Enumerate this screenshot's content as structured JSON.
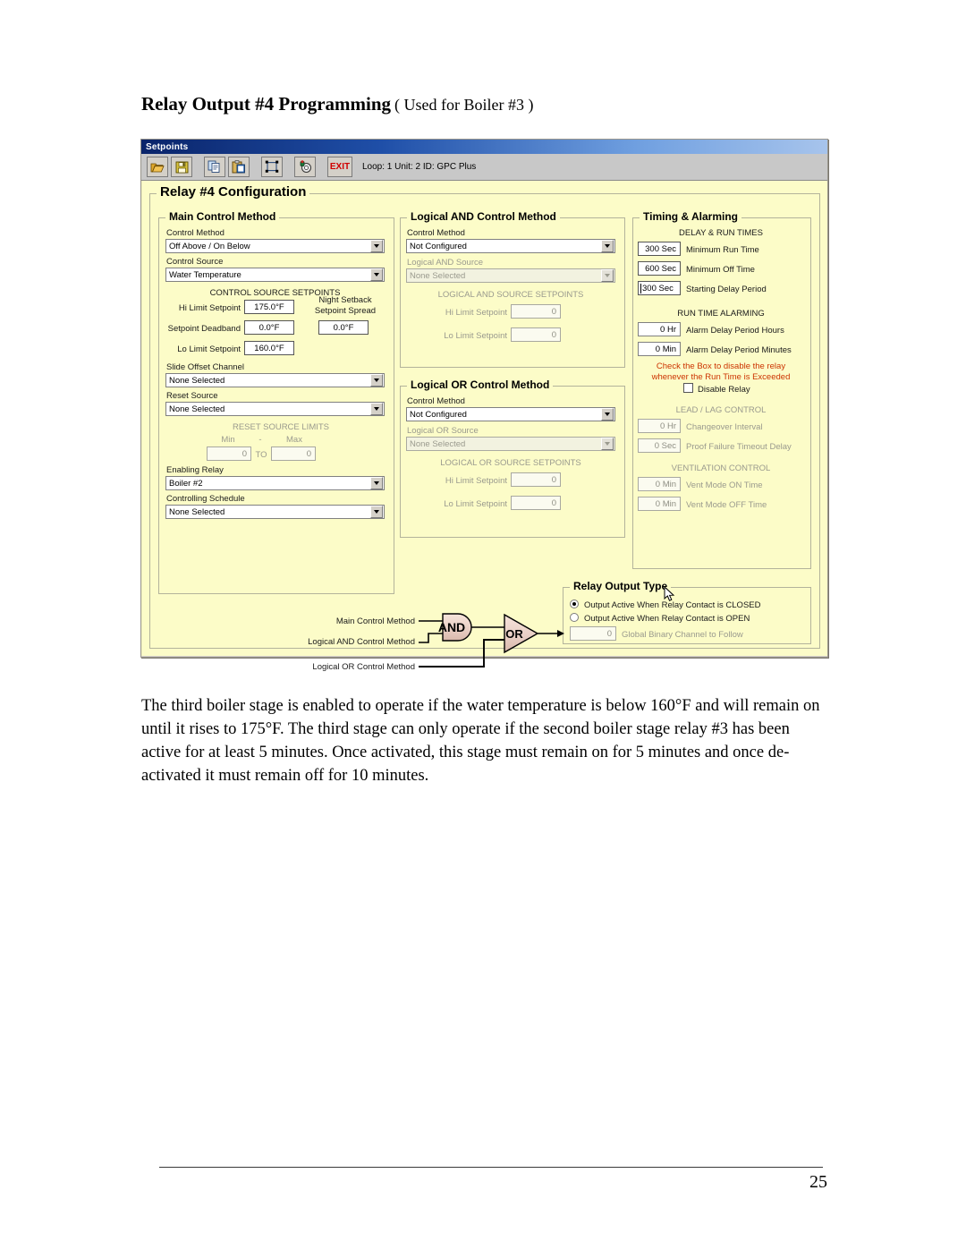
{
  "doc": {
    "heading_main": "Relay Output #4 Programming",
    "heading_sub": "( Used for Boiler #3 )",
    "paragraph": "The third boiler stage is enabled to operate if the water temperature is below 160°F and will remain on until it rises to 175°F. The third stage can only operate if the second boiler stage relay #3 has been active for at least 5 minutes. Once activated, this stage must remain on for 5 minutes and once de-activated it must remain off for 10 minutes.",
    "page_number": "25"
  },
  "window": {
    "title": "Setpoints",
    "toolbar": {
      "exit_label": "EXIT",
      "status": "Loop: 1  Unit: 2  ID: GPC Plus",
      "icons": [
        "open-folder-icon",
        "save-disk-icon",
        "copy-icon",
        "paste-icon",
        "select-frame-icon",
        "scope-icon"
      ]
    },
    "outer_group_title": "Relay #4 Configuration"
  },
  "main_control": {
    "group_title": "Main Control Method",
    "control_method_label": "Control Method",
    "control_method_value": "Off Above / On Below",
    "control_source_label": "Control Source",
    "control_source_value": "Water Temperature",
    "setpoints_header": "CONTROL SOURCE SETPOINTS",
    "hi_limit_label": "Hi Limit Setpoint",
    "hi_limit_value": "175.0°F",
    "deadband_label": "Setpoint Deadband",
    "deadband_value": "0.0°F",
    "lo_limit_label": "Lo Limit Setpoint",
    "lo_limit_value": "160.0°F",
    "night_setback_line1": "Night Setback",
    "night_setback_line2": "Setpoint Spread",
    "night_setback_value": "0.0°F",
    "slide_offset_label": "Slide Offset Channel",
    "slide_offset_value": "None Selected",
    "reset_source_label": "Reset Source",
    "reset_source_value": "None Selected",
    "reset_limits_header": "RESET SOURCE LIMITS",
    "min_label": "Min",
    "dash_label": "-",
    "max_label": "Max",
    "min_value": "0",
    "to_label": "TO",
    "max_value": "0",
    "enabling_relay_label": "Enabling Relay",
    "enabling_relay_value": "Boiler #2",
    "controlling_schedule_label": "Controlling Schedule",
    "controlling_schedule_value": "None Selected"
  },
  "logical_and": {
    "group_title": "Logical AND Control Method",
    "control_method_label": "Control Method",
    "control_method_value": "Not Configured",
    "source_label": "Logical AND Source",
    "source_value": "None Selected",
    "setpoints_header": "LOGICAL AND SOURCE SETPOINTS",
    "hi_limit_label": "Hi Limit Setpoint",
    "hi_limit_value": "0",
    "lo_limit_label": "Lo Limit Setpoint",
    "lo_limit_value": "0"
  },
  "logical_or": {
    "group_title": "Logical OR Control Method",
    "control_method_label": "Control Method",
    "control_method_value": "Not Configured",
    "source_label": "Logical OR Source",
    "source_value": "None Selected",
    "setpoints_header": "LOGICAL OR SOURCE SETPOINTS",
    "hi_limit_label": "Hi Limit Setpoint",
    "hi_limit_value": "0",
    "lo_limit_label": "Lo Limit Setpoint",
    "lo_limit_value": "0"
  },
  "timing": {
    "group_title": "Timing & Alarming",
    "delay_header": "DELAY & RUN TIMES",
    "min_run_value": "300 Sec",
    "min_run_label": "Minimum Run Time",
    "min_off_value": "600 Sec",
    "min_off_label": "Minimum Off Time",
    "start_delay_value": "300 Sec",
    "start_delay_label": "Starting Delay Period",
    "alarm_header": "RUN TIME ALARMING",
    "alarm_hours_value": "0 Hr",
    "alarm_hours_label": "Alarm Delay Period Hours",
    "alarm_minutes_value": "0 Min",
    "alarm_minutes_label": "Alarm Delay Period Minutes",
    "warning_line1": "Check the Box to disable the relay",
    "warning_line2": "whenever the Run Time is Exceeded",
    "disable_relay_label": "Disable Relay",
    "leadlag_header": "LEAD / LAG CONTROL",
    "changeover_value": "0 Hr",
    "changeover_label": "Changeover Interval",
    "proof_value": "0 Sec",
    "proof_label": "Proof Failure Timeout Delay",
    "vent_header": "VENTILATION CONTROL",
    "vent_on_value": "0 Min",
    "vent_on_label": "Vent Mode ON Time",
    "vent_off_value": "0 Min",
    "vent_off_label": "Vent Mode OFF Time"
  },
  "relay_output_type": {
    "group_title": "Relay Output Type",
    "option_closed": "Output Active When Relay Contact is CLOSED",
    "option_open": "Output Active When Relay Contact is OPEN",
    "global_binary_value": "0",
    "global_binary_label": "Global Binary Channel to Follow"
  },
  "logic_diagram": {
    "input_main": "Main Control Method",
    "input_and": "Logical AND Control Method",
    "input_or": "Logical OR Control Method",
    "and_gate": "AND",
    "or_gate": "OR"
  },
  "colors": {
    "client_bg": "#fcfcc8",
    "title_start": "#0a246a",
    "title_end": "#a7c4ec",
    "warning_red": "#cc3300",
    "exit_red": "#d00000",
    "gate_fill": "#e8cdc3"
  }
}
